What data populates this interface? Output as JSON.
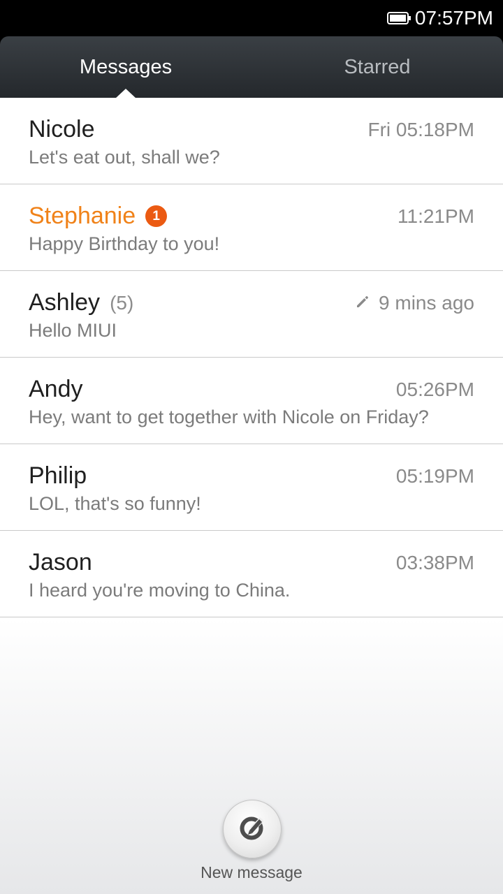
{
  "status_bar": {
    "time": "07:57PM"
  },
  "tabs": [
    {
      "label": "Messages",
      "active": true
    },
    {
      "label": "Starred",
      "active": false
    }
  ],
  "conversations": [
    {
      "name": "Nicole",
      "time": "Fri 05:18PM",
      "preview": "Let's eat out, shall we?"
    },
    {
      "name": "Stephanie",
      "unread_badge": "1",
      "time": "11:21PM",
      "preview": "Happy Birthday to you!"
    },
    {
      "name": "Ashley",
      "count": "(5)",
      "time": "9 mins ago",
      "draft_icon": "pencil-icon",
      "preview": "Hello MIUI"
    },
    {
      "name": "Andy",
      "time": "05:26PM",
      "preview": "Hey, want to get together with Nicole on Friday?"
    },
    {
      "name": "Philip",
      "time": "05:19PM",
      "preview": "LOL, that's so funny!"
    },
    {
      "name": "Jason",
      "time": "03:38PM",
      "preview": "I heard you're moving to China."
    }
  ],
  "new_message": {
    "label": "New message",
    "icon": "compose-icon"
  },
  "colors": {
    "unread_name": "#f08219",
    "badge": "#eb5a12",
    "header_bg": "#2e3236"
  }
}
